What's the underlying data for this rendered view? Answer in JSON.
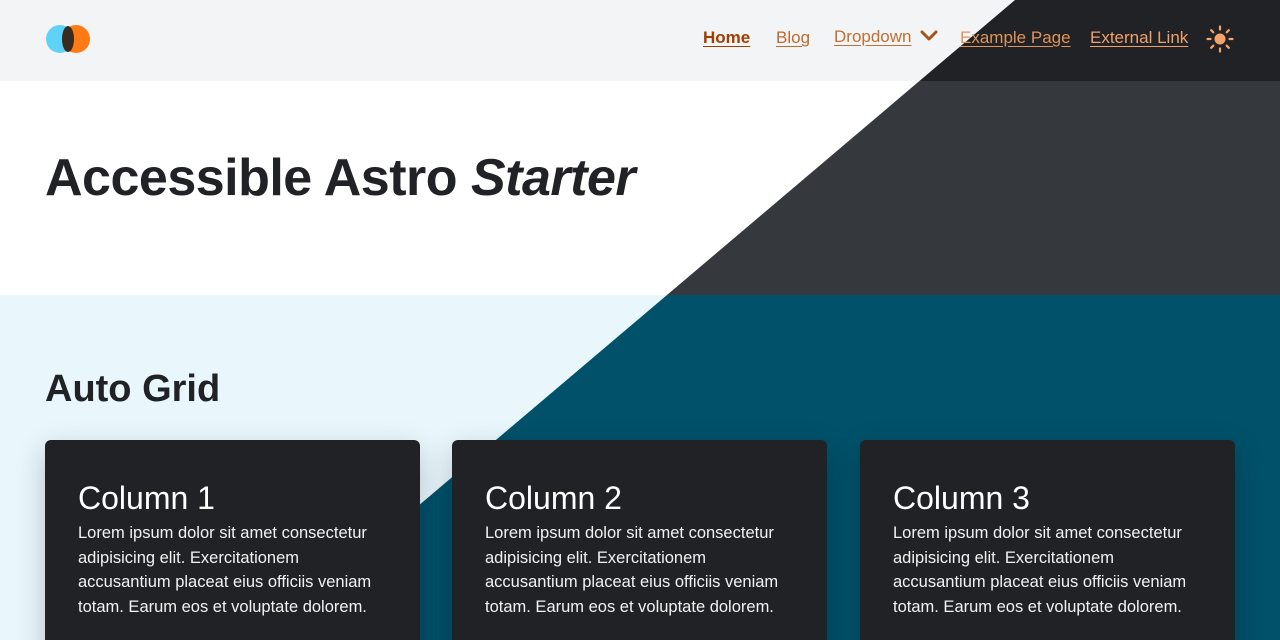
{
  "header": {
    "logo_icon": "two-overlapping-circles-logo",
    "nav": {
      "home": "Home",
      "blog": "Blog",
      "dropdown": "Dropdown",
      "example": "Example Page",
      "external": "External Link"
    },
    "theme_toggle_icon": "sun-icon"
  },
  "hero": {
    "title_main": "Accessible Astro ",
    "title_emphasis": "Starter"
  },
  "main": {
    "section_title": "Auto Grid",
    "cards": [
      {
        "title": "Column 1",
        "text": "Lorem ipsum dolor sit amet consectetur adipisicing elit. Exercitationem accusantium placeat eius officiis veniam totam. Earum eos et voluptate dolorem."
      },
      {
        "title": "Column 2",
        "text": "Lorem ipsum dolor sit amet consectetur adipisicing elit. Exercitationem accusantium placeat eius officiis veniam totam. Earum eos et voluptate dolorem."
      },
      {
        "title": "Column 3",
        "text": "Lorem ipsum dolor sit amet consectetur adipisicing elit. Exercitationem accusantium placeat eius officiis veniam totam. Earum eos et voluptate dolorem."
      }
    ]
  },
  "colors": {
    "accent": "#a33c00",
    "logo_blue": "#5ed2f7",
    "logo_orange": "#fe7a15",
    "dark_surface": "#202225",
    "teal_dark": "#01516a",
    "light_blue_bg": "#e9f7fd"
  }
}
